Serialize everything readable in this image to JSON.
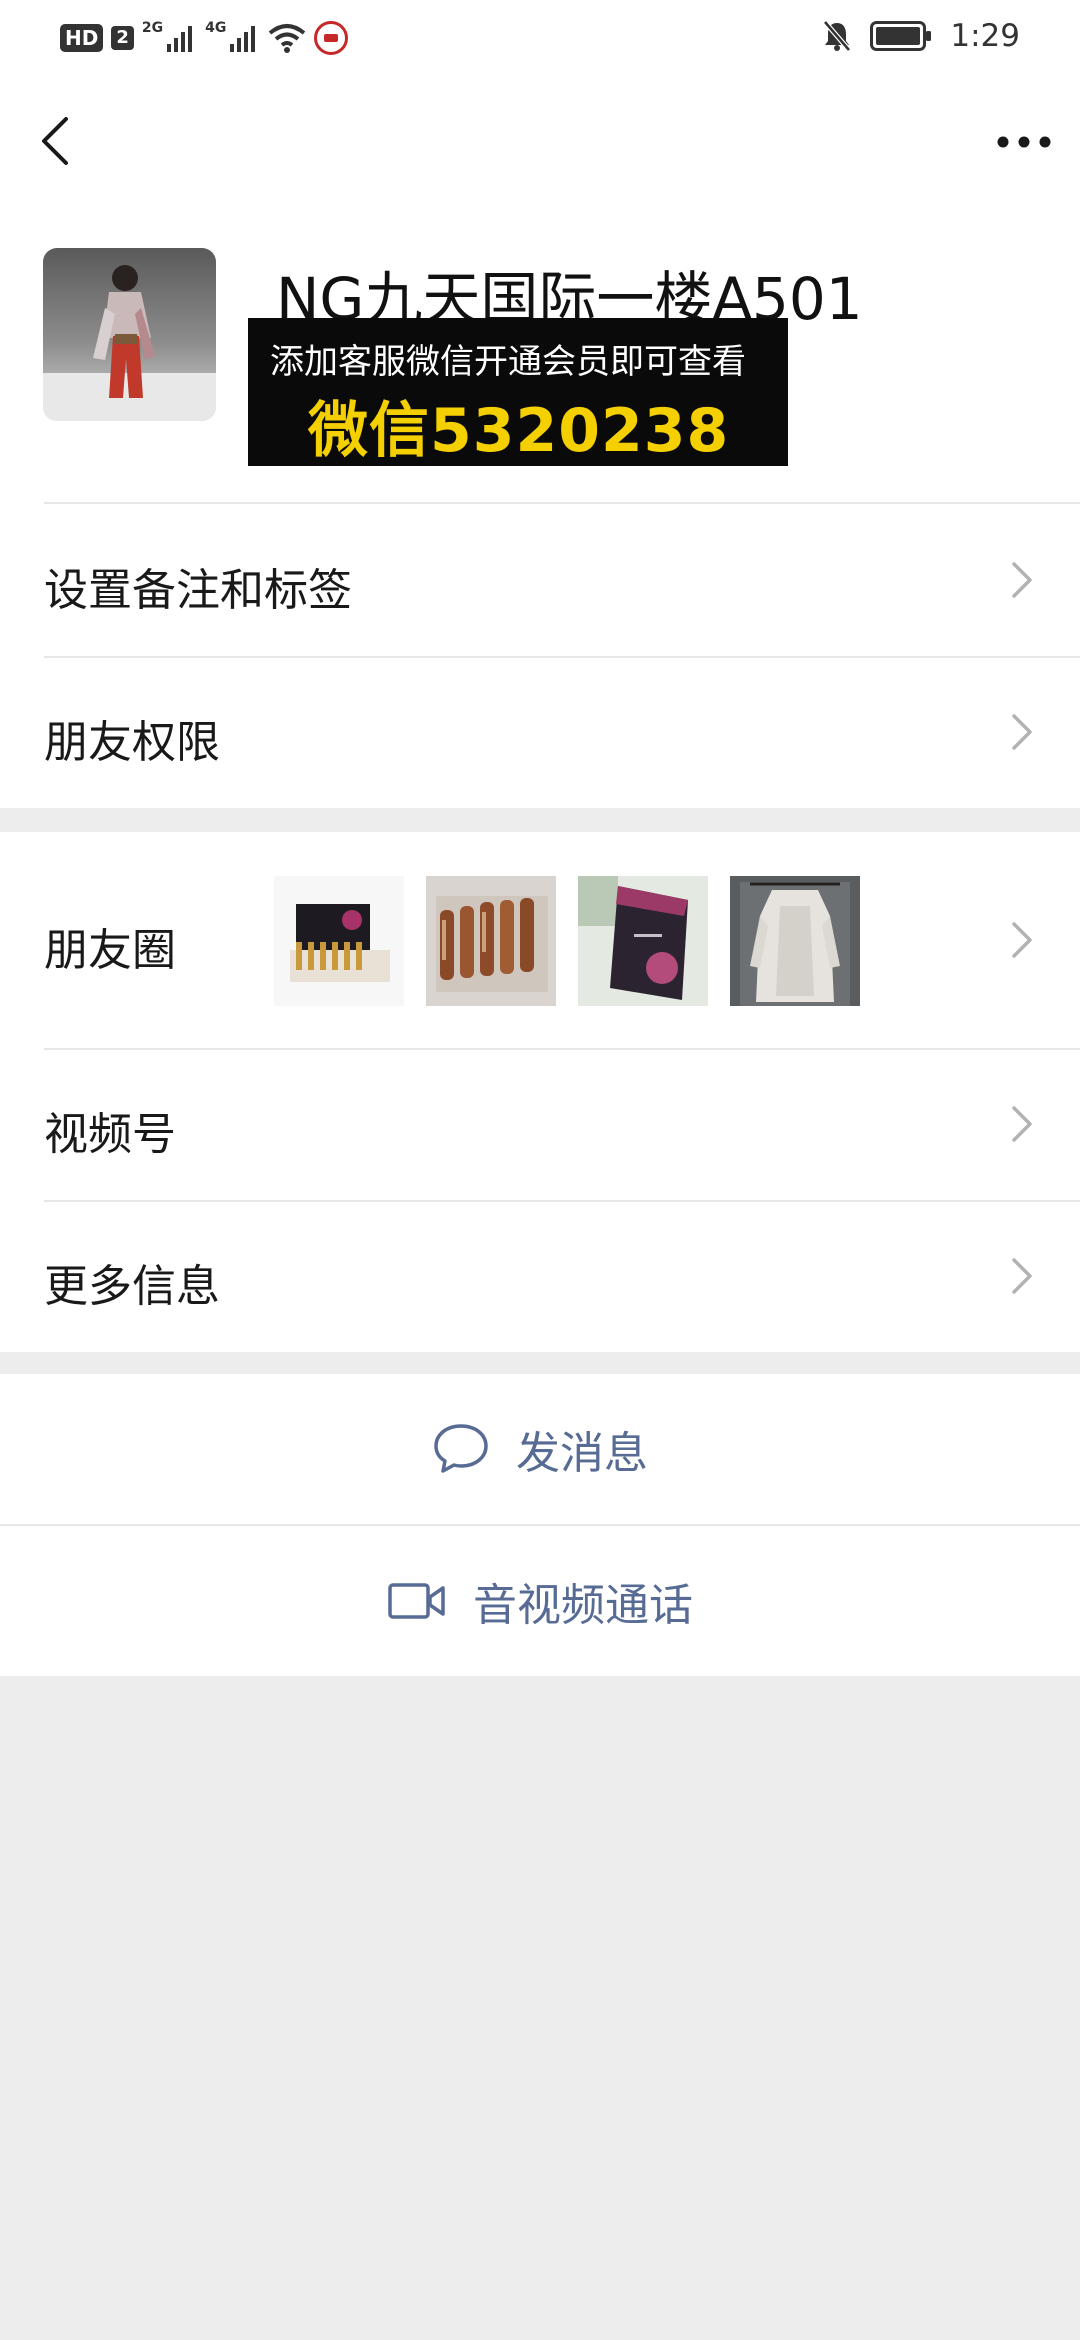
{
  "status_bar": {
    "hd": "HD",
    "sim": "2",
    "net1": "2G",
    "net2": "4G",
    "time": "1:29",
    "icons": [
      "signal-icon",
      "wifi-icon",
      "mute-bell-icon",
      "battery-icon"
    ]
  },
  "nav": {
    "back_icon": "chevron-left-icon",
    "more_icon": "more-dots-icon"
  },
  "profile": {
    "name": "NG九天国际一楼A501",
    "promo_line1": "添加客服微信开通会员即可查看",
    "promo_line2": "微信5320238"
  },
  "menu": {
    "set_remark": "设置备注和标签",
    "friend_permission": "朋友权限",
    "moments": "朋友圈",
    "channels": "视频号",
    "more_info": "更多信息"
  },
  "actions": {
    "send_message": "发消息",
    "av_call": "音视频通话"
  },
  "colors": {
    "link_blue": "#576b95",
    "background_gray": "#ededed",
    "promo_yellow": "#f5d000"
  }
}
